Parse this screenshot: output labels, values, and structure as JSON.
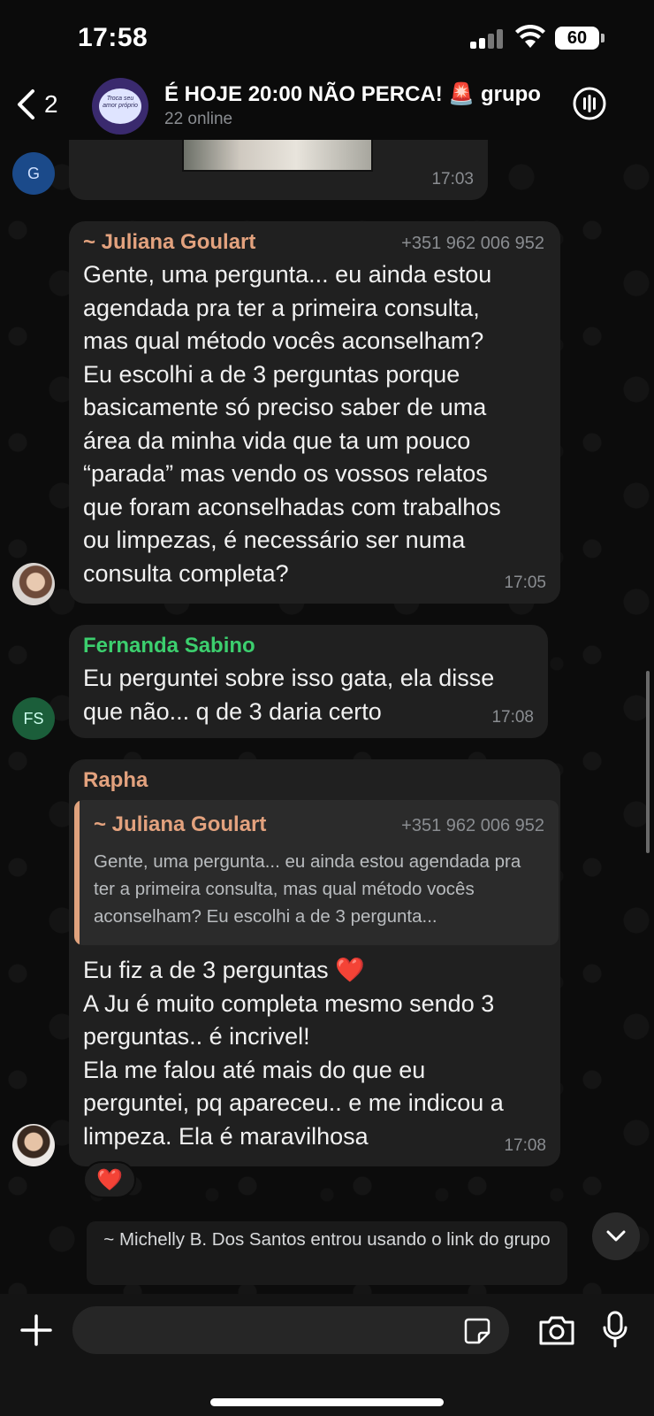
{
  "status_bar": {
    "time": "17:58",
    "battery": "60"
  },
  "header": {
    "back_count": "2",
    "group_title": "É HOJE 20:00 NÃO PERCA! 🚨 grupo",
    "subtitle": "22 online",
    "avatar_text": "Troca seu amor próprio"
  },
  "messages": [
    {
      "time": "17:03",
      "avatar_initial": "G"
    },
    {
      "sender": "~ Juliana Goulart",
      "phone": "+351 962 006 952",
      "text": "Gente, uma pergunta... eu ainda estou\nagendada pra ter a primeira consulta,\nmas qual método vocês aconselham?\nEu escolhi a de 3 perguntas porque\nbasicamente só preciso saber de uma\nárea da minha vida que ta um pouco\n“parada” mas vendo os vossos relatos\nque foram aconselhadas com trabalhos\nou limpezas, é necessário ser numa\nconsulta completa?",
      "time": "17:05"
    },
    {
      "sender": "Fernanda Sabino",
      "avatar_initial": "FS",
      "text": "Eu perguntei sobre isso gata, ela disse\nque não... q de 3 daria certo",
      "time": "17:08"
    },
    {
      "sender": "Rapha",
      "quote": {
        "sender": "~ Juliana Goulart",
        "phone": "+351 962 006 952",
        "text": "Gente, uma pergunta... eu ainda estou agendada pra ter a primeira consulta, mas qual método vocês aconselham? Eu escolhi a de 3 pergunta..."
      },
      "text": "Eu fiz a de 3 perguntas ❤️\nA Ju é muito completa mesmo sendo 3\nperguntas.. é incrivel!\nEla me falou até mais do que eu\nperguntei, pq apareceu.. e me indicou a\nlimpeza. Ela é maravilhosa",
      "time": "17:08",
      "reaction": "❤️"
    }
  ],
  "system_message": "~ Michelly B. Dos Santos entrou usando o link do grupo",
  "input": {
    "placeholder": ""
  },
  "colors": {
    "juliana": "#e3a27e",
    "fernanda": "#3ccf6e",
    "rapha": "#e3a27e",
    "bubble": "#202020"
  }
}
